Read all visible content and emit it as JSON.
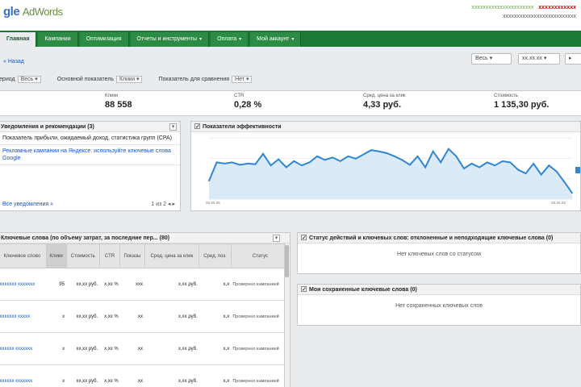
{
  "app": {
    "logo_prefix": "gle",
    "logo_name": "AdWords"
  },
  "account": {
    "email": "xxxxxxxxxxxxxxxxxxxxxx",
    "acct_id": "xxxxxxxxxxxx",
    "sub_line": "xxxxxxxxxxxxxxxxxxxxxxxxxx"
  },
  "nav": {
    "tabs": [
      {
        "label": "Главная",
        "active": true,
        "caret": false
      },
      {
        "label": "Кампании",
        "active": false,
        "caret": false
      },
      {
        "label": "Оптимизация",
        "active": false,
        "caret": false
      },
      {
        "label": "Отчеты и инструменты",
        "active": false,
        "caret": true
      },
      {
        "label": "Оплата",
        "active": false,
        "caret": true
      },
      {
        "label": "Мой аккаунт",
        "active": false,
        "caret": true
      }
    ]
  },
  "subbar": {
    "home_link": "« Назад",
    "date_range": "Весь",
    "date_value": "xx.xx.xx",
    "controls": [
      {
        "label": "Период",
        "value": "Весь"
      },
      {
        "label": "Основной показатель",
        "value": "Клики"
      },
      {
        "label": "Показатель для сравнения",
        "value": "Нет"
      }
    ]
  },
  "metrics": [
    {
      "label": "Клики",
      "value": "88 558"
    },
    {
      "label": "CTR",
      "value": "0,28 %"
    },
    {
      "label": "Сред. цена за клик",
      "value": "4,33 руб."
    },
    {
      "label": "Стоимость",
      "value": "1 135,30 руб."
    }
  ],
  "alerts": {
    "title": "Уведомления и рекомендации (3)",
    "items": [
      {
        "text": "Показатель прибыли, ожидаемый доход, статистика групп (CPA)",
        "blue": false
      },
      {
        "text": "Рекламные кампании на Яндексе: используйте ключевые слова Google",
        "blue": true
      }
    ],
    "footer": "Все уведомления »",
    "pager": "1 из 2 ◂ ▸"
  },
  "chart_data": {
    "type": "line",
    "title": "Показатели эффективности",
    "x_start": "xx.xx.xx",
    "x_end": "xx.xx.xx",
    "values": [
      30,
      60,
      58,
      60,
      56,
      58,
      57,
      74,
      55,
      65,
      52,
      62,
      55,
      60,
      70,
      64,
      68,
      62,
      70,
      66,
      73,
      80,
      78,
      75,
      70,
      64,
      56,
      70,
      52,
      78,
      60,
      82,
      70,
      50,
      58,
      52,
      60,
      55,
      62,
      60,
      48,
      42,
      58,
      40,
      55,
      45,
      28,
      10
    ],
    "ylim": [
      0,
      100
    ],
    "color": "#2f86d4",
    "fill": "#dbeaf7"
  },
  "keywords": {
    "title": "Ключевые слова (по объему затрат, за последние пер... (80)",
    "columns": [
      "Ключевое слово",
      "Клики",
      "Стоимость",
      "CTR",
      "Показы",
      "Сред. цена за клик",
      "Сред. поз.",
      "Статус"
    ],
    "rows": [
      {
        "keyword": "xxxxxxx xxxxxxx",
        "clicks": "95",
        "cost": "xx,xx руб.",
        "ctr": "x,xx %",
        "impr": "xxx",
        "cpc": "x,xx руб.",
        "pos": "x,x",
        "status": "Проверено кампанией"
      },
      {
        "keyword": "xxxxxxx xxxxx",
        "clicks": "x",
        "cost": "xx,xx руб.",
        "ctr": "x,xx %",
        "impr": "xx",
        "cpc": "x,xx руб.",
        "pos": "x,x",
        "status": "Проверено кампанией"
      },
      {
        "keyword": "xxxxxx xxxxxxx",
        "clicks": "x",
        "cost": "xx,xx руб.",
        "ctr": "x,xx %",
        "impr": "xx",
        "cpc": "x,xx руб.",
        "pos": "x,x",
        "status": "Проверено кампанией"
      },
      {
        "keyword": "xxxxxx xxxxxxx",
        "clicks": "x",
        "cost": "xx,xx руб.",
        "ctr": "x,xx %",
        "impr": "xx",
        "cpc": "x,xx руб.",
        "pos": "x,x",
        "status": "Проверено кампанией"
      }
    ]
  },
  "box1": {
    "title": "Статус действий и ключевых слов: отклоненные и неподходящие ключевые слова (0)",
    "empty": "Нет ключевых слов со статусом"
  },
  "box2": {
    "title": "Мои сохраненные ключевые слова (0)",
    "empty": "Нет сохраненных ключевых слов"
  }
}
